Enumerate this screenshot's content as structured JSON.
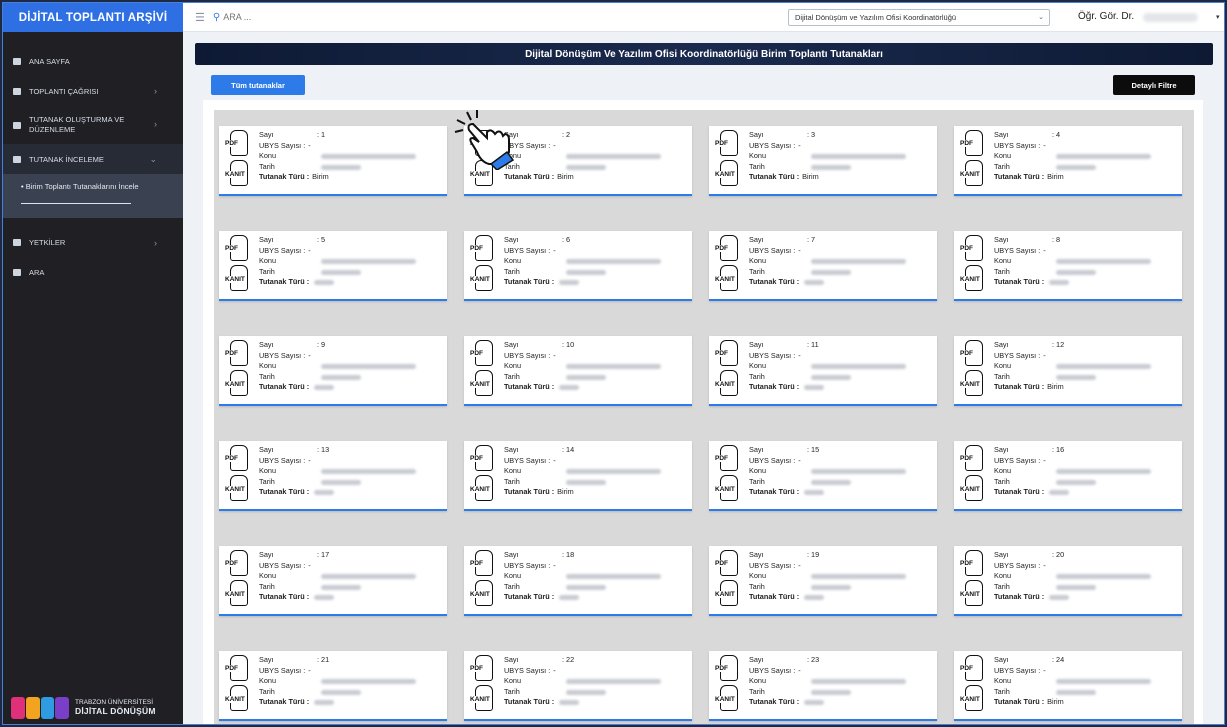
{
  "app": {
    "brand": "DİJİTAL TOPLANTI ARŞİVİ"
  },
  "sidebar": {
    "items": [
      {
        "label": "ANA SAYFA",
        "chevron": ""
      },
      {
        "label": "TOPLANTI ÇAĞRISI",
        "chevron": "›"
      },
      {
        "label": "TUTANAK OLUŞTURMA VE DÜZENLEME",
        "chevron": "›"
      },
      {
        "label": "TUTANAK İNCELEME",
        "chevron": "⌄"
      },
      {
        "label": "YETKİLER",
        "chevron": "›"
      },
      {
        "label": "ARA",
        "chevron": ""
      }
    ],
    "sub_item": "Birim Toplantı Tutanaklarını İncele",
    "logo": {
      "line1": "TRABZON ÜNİVERSİTESİ",
      "line2": "DİJİTAL DÖNÜŞÜM"
    }
  },
  "topbar": {
    "search_placeholder": "ARA ...",
    "unit_select": "Dijital Dönüşüm ve Yazılım Ofisi Koordinatörlüğü",
    "user": "Öğr. Gör. Dr."
  },
  "main": {
    "title": "Dijital Dönüşüm Ve Yazılım Ofisi Koordinatörlüğü Birim Toplantı Tutanakları",
    "tab_all": "Tüm tutanaklar",
    "filter_button": "Detaylı Filtre"
  },
  "card_labels": {
    "pdf": "PDF",
    "kanit": "KANIT",
    "sayi": "Sayı",
    "ubys": "UBYS Sayısı :",
    "konu": "Konu",
    "tarih": "Tarih",
    "tur": "Tutanak Türü :"
  },
  "cards": [
    {
      "sayi": ": 1",
      "ubys": "-",
      "tur": "Birim",
      "tur_blur": false
    },
    {
      "sayi": ": 2",
      "ubys": "-",
      "tur": "Birim",
      "tur_blur": false
    },
    {
      "sayi": ": 3",
      "ubys": "-",
      "tur": "Birim",
      "tur_blur": false
    },
    {
      "sayi": ": 4",
      "ubys": "-",
      "tur": "Birim",
      "tur_blur": false
    },
    {
      "sayi": ": 5",
      "ubys": "-",
      "tur": "Birim",
      "tur_blur": true
    },
    {
      "sayi": ": 6",
      "ubys": "-",
      "tur": "Birim",
      "tur_blur": true
    },
    {
      "sayi": ": 7",
      "ubys": "-",
      "tur": "Birim",
      "tur_blur": true
    },
    {
      "sayi": ": 8",
      "ubys": "-",
      "tur": "Birim",
      "tur_blur": true
    },
    {
      "sayi": ": 9",
      "ubys": "-",
      "tur": "Birim",
      "tur_blur": true
    },
    {
      "sayi": ": 10",
      "ubys": "-",
      "tur": "Birim",
      "tur_blur": true
    },
    {
      "sayi": ": 11",
      "ubys": "-",
      "tur": "Birim",
      "tur_blur": true
    },
    {
      "sayi": ": 12",
      "ubys": "-",
      "tur": "Birim",
      "tur_blur": false
    },
    {
      "sayi": ": 13",
      "ubys": "-",
      "tur": "Birim",
      "tur_blur": true
    },
    {
      "sayi": ": 14",
      "ubys": "-",
      "tur": "Birim",
      "tur_blur": false
    },
    {
      "sayi": ": 15",
      "ubys": "-",
      "tur": "Birim",
      "tur_blur": true
    },
    {
      "sayi": ": 16",
      "ubys": "-",
      "tur": "Birim",
      "tur_blur": true
    },
    {
      "sayi": ": 17",
      "ubys": "-",
      "tur": "Birim",
      "tur_blur": true
    },
    {
      "sayi": ": 18",
      "ubys": "-",
      "tur": "Birim",
      "tur_blur": true
    },
    {
      "sayi": ": 19",
      "ubys": "-",
      "tur": "Birim",
      "tur_blur": true
    },
    {
      "sayi": ": 20",
      "ubys": "-",
      "tur": "Birim",
      "tur_blur": true
    },
    {
      "sayi": ": 21",
      "ubys": "-",
      "tur": "Birim",
      "tur_blur": true
    },
    {
      "sayi": ": 22",
      "ubys": "-",
      "tur": "Birim",
      "tur_blur": true
    },
    {
      "sayi": ": 23",
      "ubys": "-",
      "tur": "Birim",
      "tur_blur": true
    },
    {
      "sayi": ": 24",
      "ubys": "-",
      "tur": "Birim",
      "tur_blur": false
    }
  ],
  "colors": {
    "accent": "#2d7be8",
    "sidebar": "#1f1f24",
    "banner": "#0e1a34"
  }
}
